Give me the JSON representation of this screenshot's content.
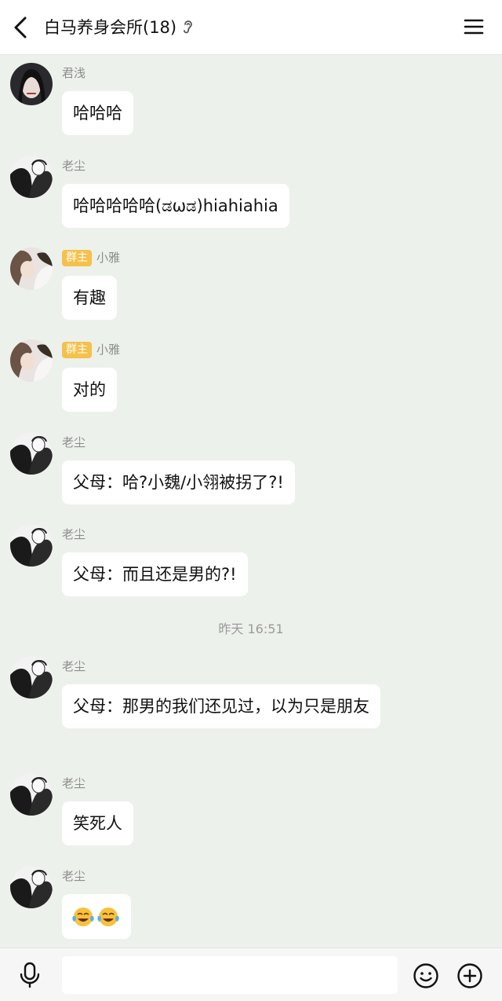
{
  "header": {
    "title": "白马养身会所(18)",
    "back_icon": "chevron-left-icon",
    "ear_icon": "ear-icon",
    "menu_icon": "hamburger-menu-icon"
  },
  "messages": [
    {
      "sender": "君浅",
      "badge": "",
      "text": "哈哈哈",
      "avatar": "avatar-junqian"
    },
    {
      "sender": "老尘",
      "badge": "",
      "text": "哈哈哈哈哈(ಡωಡ)hiahiahia",
      "avatar": "avatar-laochen"
    },
    {
      "sender": "小雅",
      "badge": "群主",
      "text": "有趣",
      "avatar": "avatar-xiaoya"
    },
    {
      "sender": "小雅",
      "badge": "群主",
      "text": "对的",
      "avatar": "avatar-xiaoya"
    },
    {
      "sender": "老尘",
      "badge": "",
      "text": "父母：哈?小魏/小翎被拐了?!",
      "avatar": "avatar-laochen"
    },
    {
      "sender": "老尘",
      "badge": "",
      "text": "父母：而且还是男的?!",
      "avatar": "avatar-laochen"
    },
    {
      "sender": "老尘",
      "badge": "",
      "text": "父母：那男的我们还见过，以为只是朋友",
      "avatar": "avatar-laochen"
    },
    {
      "sender": "老尘",
      "badge": "",
      "text": "笑死人",
      "avatar": "avatar-laochen"
    },
    {
      "sender": "老尘",
      "badge": "",
      "text": "",
      "emoji": [
        "tears-of-joy-emoji",
        "tears-of-joy-emoji"
      ],
      "avatar": "avatar-laochen"
    }
  ],
  "timestamp": "昨天 16:51",
  "footer": {
    "mic_icon": "microphone-icon",
    "input_value": "",
    "emoji_icon": "smiley-icon",
    "plus_icon": "plus-circle-icon"
  }
}
